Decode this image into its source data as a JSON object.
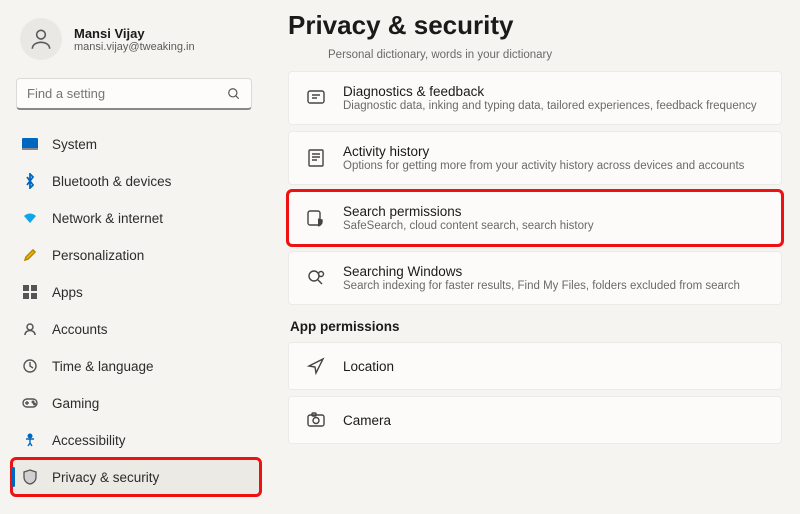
{
  "user": {
    "name": "Mansi Vijay",
    "email": "mansi.vijay@tweaking.in"
  },
  "search": {
    "placeholder": "Find a setting"
  },
  "sidebar": {
    "items": [
      {
        "label": "System"
      },
      {
        "label": "Bluetooth & devices"
      },
      {
        "label": "Network & internet"
      },
      {
        "label": "Personalization"
      },
      {
        "label": "Apps"
      },
      {
        "label": "Accounts"
      },
      {
        "label": "Time & language"
      },
      {
        "label": "Gaming"
      },
      {
        "label": "Accessibility"
      },
      {
        "label": "Privacy & security"
      }
    ]
  },
  "main": {
    "title": "Privacy & security",
    "partial": "Personal dictionary, words in your dictionary",
    "cards": [
      {
        "title": "Diagnostics & feedback",
        "sub": "Diagnostic data, inking and typing data, tailored experiences, feedback frequency"
      },
      {
        "title": "Activity history",
        "sub": "Options for getting more from your activity history across devices and accounts"
      },
      {
        "title": "Search permissions",
        "sub": "SafeSearch, cloud content search, search history"
      },
      {
        "title": "Searching Windows",
        "sub": "Search indexing for faster results, Find My Files, folders excluded from search"
      }
    ],
    "section": "App permissions",
    "perm_cards": [
      {
        "title": "Location"
      },
      {
        "title": "Camera"
      }
    ]
  }
}
